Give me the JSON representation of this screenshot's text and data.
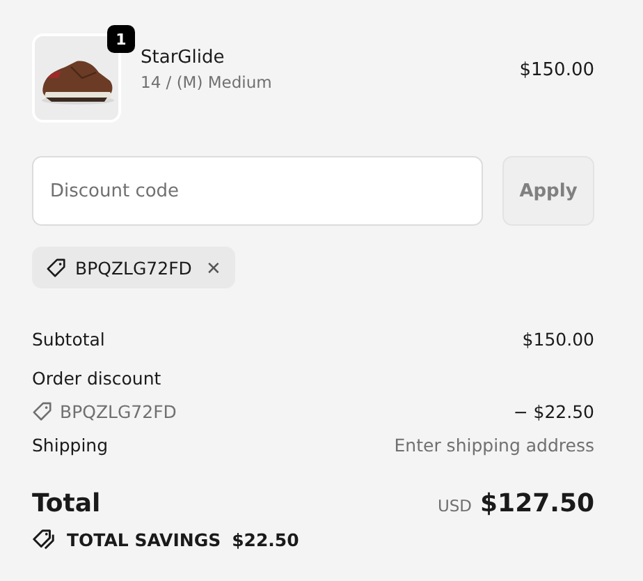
{
  "line_items": [
    {
      "name": "StarGlide",
      "variant": "14 / (M) Medium",
      "price": "$150.00",
      "quantity": "1"
    }
  ],
  "discount": {
    "placeholder": "Discount code",
    "button": "Apply",
    "applied_codes": [
      {
        "code": "BPQZLG72FD",
        "remove": "✕"
      }
    ]
  },
  "summary": {
    "subtotal": {
      "label": "Subtotal",
      "value": "$150.00"
    },
    "order_discount": {
      "label": "Order discount",
      "code": "BPQZLG72FD",
      "value": "− $22.50"
    },
    "shipping": {
      "label": "Shipping",
      "value": "Enter shipping address"
    },
    "total": {
      "label": "Total",
      "currency": "USD",
      "value": "$127.50"
    },
    "savings": {
      "label": "TOTAL SAVINGS",
      "value": "$22.50"
    }
  }
}
